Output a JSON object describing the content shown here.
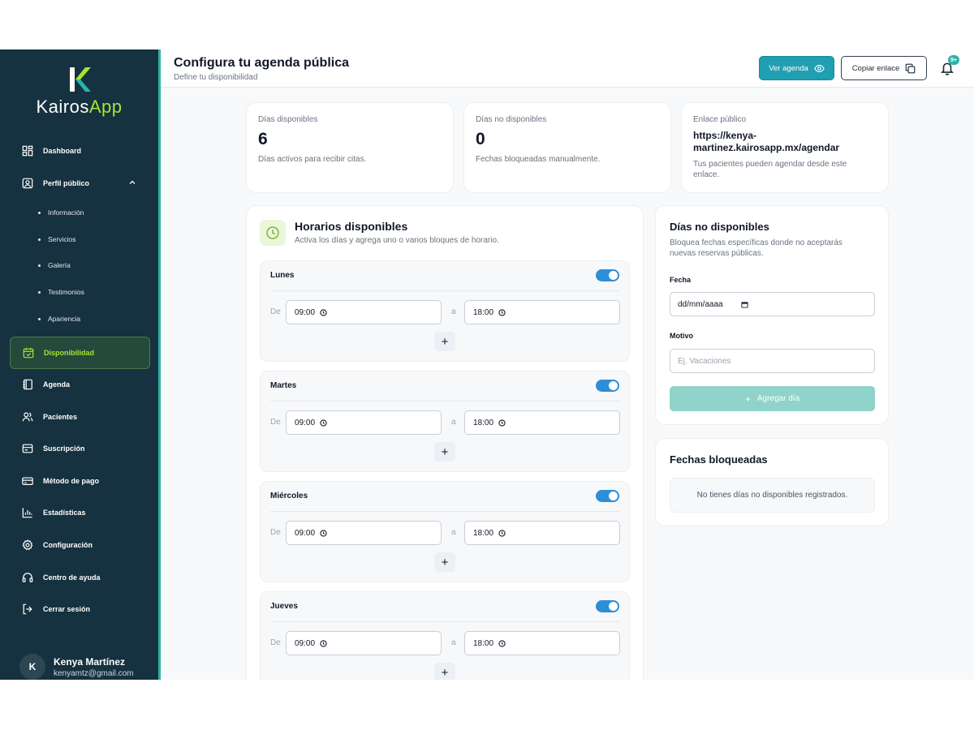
{
  "brand": {
    "name_part1": "Kairos",
    "name_part2": "App"
  },
  "header": {
    "title": "Configura tu agenda pública",
    "subtitle": "Define tu disponibilidad",
    "view_button": "Ver agenda",
    "copy_button": "Copiar enlace",
    "notification_badge": "9+"
  },
  "sidebar": {
    "items": [
      {
        "label": "Dashboard",
        "icon": "dashboard-icon"
      },
      {
        "label": "Perfil público",
        "icon": "profile-icon"
      },
      {
        "label": "Disponibilidad",
        "icon": "calendar-check-icon",
        "active": true
      },
      {
        "label": "Agenda",
        "icon": "notebook-icon"
      },
      {
        "label": "Pacientes",
        "icon": "users-icon"
      },
      {
        "label": "Suscripción",
        "icon": "subscription-icon"
      },
      {
        "label": "Método de pago",
        "icon": "credit-card-icon"
      },
      {
        "label": "Estadísticas",
        "icon": "bar-chart-icon"
      },
      {
        "label": "Configuración",
        "icon": "gear-icon"
      },
      {
        "label": "Centro de ayuda",
        "icon": "headset-icon"
      },
      {
        "label": "Cerrar sesión",
        "icon": "logout-icon"
      }
    ],
    "subitems": [
      "Información",
      "Servicios",
      "Galería",
      "Testimonios",
      "Apariencia"
    ]
  },
  "user": {
    "initial": "K",
    "name": "Kenya Martínez",
    "email": "kenyamtz@gmail.com"
  },
  "stats": [
    {
      "label": "Días disponibles",
      "value": "6",
      "desc": "Días activos para recibir citas."
    },
    {
      "label": "Días no disponibles",
      "value": "0",
      "desc": "Fechas bloqueadas manualmente."
    }
  ],
  "public_link": {
    "label": "Enlace público",
    "url": "https://kenya-martinez.kairosapp.mx/agendar",
    "desc": "Tus pacientes pueden agendar desde este enlace."
  },
  "schedule": {
    "title": "Horarios disponibles",
    "subtitle": "Activa los días y agrega uno o varios bloques de horario.",
    "from_label": "De",
    "to_label": "a",
    "add_symbol": "+",
    "days": [
      {
        "name": "Lunes",
        "enabled": true,
        "start": "09:00",
        "end": "18:00"
      },
      {
        "name": "Martes",
        "enabled": true,
        "start": "09:00",
        "end": "18:00"
      },
      {
        "name": "Miércoles",
        "enabled": true,
        "start": "09:00",
        "end": "18:00"
      },
      {
        "name": "Jueves",
        "enabled": true,
        "start": "09:00",
        "end": "18:00"
      }
    ]
  },
  "unavailable": {
    "title": "Días no disponibles",
    "subtitle": "Bloquea fechas específicas donde no aceptarás nuevas reservas públicas.",
    "date_label": "Fecha",
    "date_placeholder": "dd/mm/aaaa",
    "reason_label": "Motivo",
    "reason_placeholder": "Ej. Vacaciones",
    "add_button": "Agregar día"
  },
  "blocked": {
    "title": "Fechas bloqueadas",
    "empty": "No tienes días no disponibles registrados."
  },
  "colors": {
    "sidebar_bg": "#16313f",
    "accent_teal": "#1f9fb0",
    "accent_lime": "#a3e635",
    "toggle_blue": "#2d8ed8"
  }
}
